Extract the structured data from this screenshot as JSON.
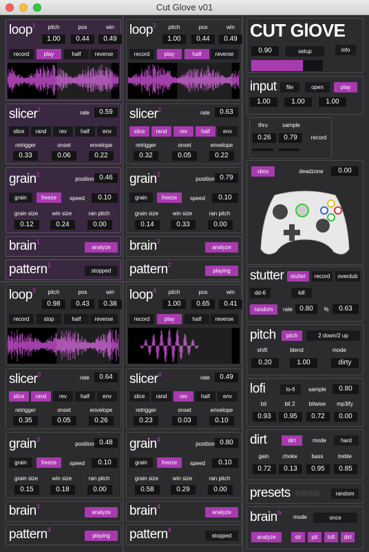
{
  "window": {
    "title": "Cut Glove v01"
  },
  "loops": [
    {
      "num": "1",
      "pitch": "1.00",
      "pos": "0.44",
      "win": "0.49",
      "active": [
        "play"
      ]
    },
    {
      "num": "2",
      "pitch": "1.00",
      "pos": "0.44",
      "win": "0.49",
      "active": [
        "play",
        "half"
      ]
    },
    {
      "num": "3",
      "pitch": "0.98",
      "pos": "0.43",
      "win": "0.38",
      "active": []
    },
    {
      "num": "4",
      "pitch": "1.00",
      "pos": "0.65",
      "win": "0.41",
      "active": [
        "play"
      ]
    }
  ],
  "slicers": [
    {
      "num": "1",
      "rate": "0.59",
      "retrigger": "0.33",
      "onset": "0.06",
      "envelope": "0.22",
      "active": []
    },
    {
      "num": "2",
      "rate": "0.63",
      "retrigger": "0.32",
      "onset": "0.05",
      "envelope": "0.22",
      "active": [
        "slice",
        "rand",
        "rev",
        "half"
      ]
    },
    {
      "num": "3",
      "rate": "0.64",
      "retrigger": "0.35",
      "onset": "0.05",
      "envelope": "0.26",
      "active": [
        "slice",
        "rand"
      ]
    },
    {
      "num": "4",
      "rate": "0.49",
      "retrigger": "0.23",
      "onset": "0.03",
      "envelope": "0.10",
      "active": [
        "rev"
      ]
    }
  ],
  "grains": [
    {
      "num": "1",
      "position": "0.46",
      "speed": "0.10",
      "grain_size": "0.12",
      "win_size": "0.24",
      "ran_pitch": "0.00"
    },
    {
      "num": "2",
      "position": "0.79",
      "speed": "0.10",
      "grain_size": "0.14",
      "win_size": "0.33",
      "ran_pitch": "0.00"
    },
    {
      "num": "3",
      "position": "0.48",
      "speed": "0.10",
      "grain_size": "0.15",
      "win_size": "0.18",
      "ran_pitch": "0.00"
    },
    {
      "num": "4",
      "position": "0.80",
      "speed": "0.10",
      "grain_size": "0.58",
      "win_size": "0.29",
      "ran_pitch": "0.00"
    }
  ],
  "brains": [
    {
      "num": "1"
    },
    {
      "num": "2"
    },
    {
      "num": "3"
    },
    {
      "num": "4"
    }
  ],
  "patterns": [
    {
      "num": "1",
      "status": "stopped",
      "on": false
    },
    {
      "num": "2",
      "status": "playing",
      "on": true
    },
    {
      "num": "3",
      "status": "playing",
      "on": true
    },
    {
      "num": "4",
      "status": "stopped",
      "on": false
    }
  ],
  "labels": {
    "loop": "loop",
    "slicer": "slicer",
    "grain": "grain",
    "brain": "brain",
    "pattern": "pattern",
    "pitch": "pitch",
    "pos": "pos",
    "win": "win",
    "record": "record",
    "play": "play",
    "stop": "stop",
    "half": "half",
    "reverse": "reverse",
    "rate": "rate",
    "slice": "slice",
    "rand": "rand",
    "rev": "rev",
    "env": "env",
    "retrigger": "retrigger",
    "onset": "onset",
    "envelope": "envelope",
    "position": "position",
    "freeze": "freeze",
    "speed": "speed",
    "grain_size": "grain size",
    "win_size": "win size",
    "ran_pitch": "ran pitch",
    "analyze": "analyze"
  },
  "header": {
    "title": "CUT GlOVE",
    "value": "0.90",
    "setup": "setup",
    "info": "info",
    "level": 0.72
  },
  "input": {
    "title": "input",
    "file": "file",
    "open": "open",
    "play": "play",
    "v1": "1.00",
    "v2": "1.00",
    "v3": "1.00",
    "thru_label": "thru",
    "sample_label": "sample",
    "thru": "0.26",
    "sample": "0.79",
    "record": "record"
  },
  "xbox": {
    "button": "xbox",
    "deadzone_label": "deadzone",
    "deadzone": "0.00"
  },
  "stutter": {
    "title": "stutter",
    "stutter": "stutter",
    "record": "record",
    "overdub": "overdub",
    "dd": "dd-6",
    "kill": "kill",
    "random": "random",
    "rate_label": "rate",
    "rate": "0.80",
    "pct_label": "%",
    "pct": "0.63"
  },
  "pitchfx": {
    "title": "pitch",
    "button": "pitch",
    "mode": "2 down/2 up",
    "shift_label": "shift",
    "blend_label": "blend",
    "mode_label": "mode",
    "shift": "0.20",
    "blend": "1.00",
    "mode_val": "dirty"
  },
  "lofi": {
    "title": "lofi",
    "button": "lo-fi",
    "sample_label": "sample",
    "sample": "0.80",
    "bit_label": "bit",
    "bit2_label": "bit 2",
    "bitwise_label": "bitwise",
    "mp3_label": "mp3ify",
    "bit": "0.93",
    "bit2": "0.95",
    "bitwise": "0.72",
    "mp3": "0.00"
  },
  "dirt": {
    "title": "dirt",
    "button": "dirt",
    "mode_label": "mode",
    "mode": "hard",
    "gain_label": "gain",
    "choke_label": "choke",
    "bass_label": "bass",
    "treble_label": "treble",
    "gain": "0.72",
    "choke": "0.13",
    "bass": "0.95",
    "treble": "0.85"
  },
  "presets": {
    "title": "presets",
    "random": "random"
  },
  "brainfx": {
    "title": "brain",
    "sup": "fx",
    "mode_label": "mode",
    "mode": "once",
    "analyze": "analyze",
    "str": "str",
    "pit": "pit",
    "lofi": "lofi",
    "dirt": "dirt"
  },
  "colors": {
    "accent": "#a83ab0",
    "panel": "#2c2c2e",
    "highlight": "#3a2840"
  }
}
